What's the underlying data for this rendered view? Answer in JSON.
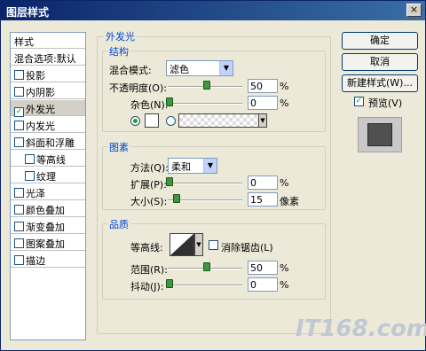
{
  "window": {
    "title": "图层样式",
    "close_label": "×"
  },
  "left_panel": {
    "items": [
      {
        "label": "样式",
        "checked": null
      },
      {
        "label": "混合选项:默认",
        "checked": null
      },
      {
        "label": "投影",
        "checked": false
      },
      {
        "label": "内阴影",
        "checked": false
      },
      {
        "label": "外发光",
        "checked": true
      },
      {
        "label": "内发光",
        "checked": false
      },
      {
        "label": "斜面和浮雕",
        "checked": false
      },
      {
        "label": "等高线",
        "checked": false
      },
      {
        "label": "纹理",
        "checked": false
      },
      {
        "label": "光泽",
        "checked": false
      },
      {
        "label": "颜色叠加",
        "checked": false
      },
      {
        "label": "渐变叠加",
        "checked": false
      },
      {
        "label": "图案叠加",
        "checked": false
      },
      {
        "label": "描边",
        "checked": false
      }
    ]
  },
  "outer_glow": {
    "title": "外发光",
    "structure": {
      "title": "结构",
      "blend_mode_label": "混合模式:",
      "blend_mode_value": "滤色",
      "opacity_label": "不透明度(O):",
      "opacity_value": "50",
      "opacity_unit": "%",
      "noise_label": "杂色(N):",
      "noise_value": "0",
      "noise_unit": "%"
    },
    "elements": {
      "title": "图素",
      "method_label": "方法(Q):",
      "method_value": "柔和",
      "spread_label": "扩展(P):",
      "spread_value": "0",
      "spread_unit": "%",
      "size_label": "大小(S):",
      "size_value": "15",
      "size_unit": "像素"
    },
    "quality": {
      "title": "品质",
      "contour_label": "等高线:",
      "anti_alias_label": "消除锯齿(L)",
      "range_label": "范围(R):",
      "range_value": "50",
      "range_unit": "%",
      "jitter_label": "抖动(J):",
      "jitter_value": "0",
      "jitter_unit": "%"
    }
  },
  "buttons": {
    "ok": "确定",
    "cancel": "取消",
    "new_style": "新建样式(W)...",
    "preview_label": "预览(V)"
  },
  "watermark": "IT168.com"
}
